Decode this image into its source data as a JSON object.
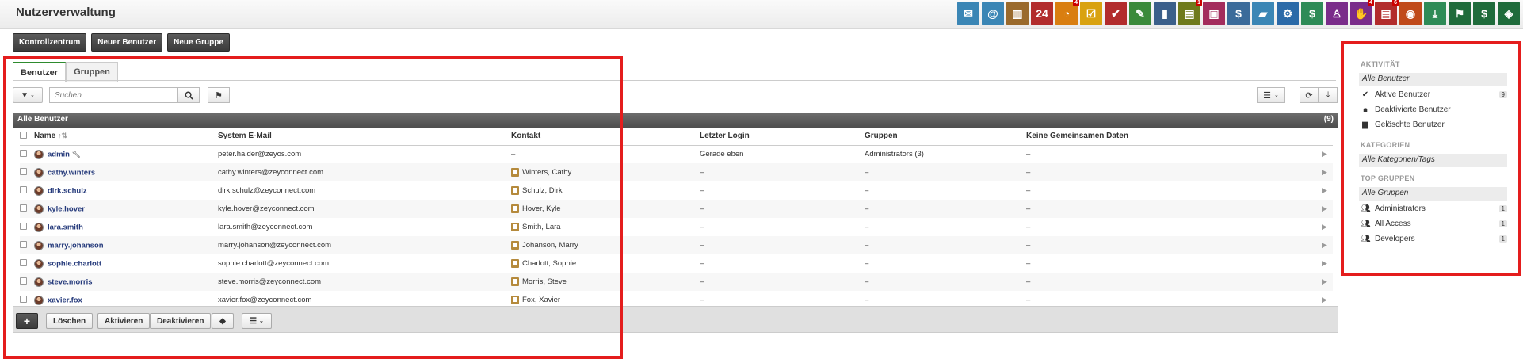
{
  "page_title": "Nutzerverwaltung",
  "apps": [
    {
      "icon": "mail-icon",
      "color": "#3b86b5",
      "glyph": "✉"
    },
    {
      "icon": "at-icon",
      "color": "#3b86b5",
      "glyph": "@"
    },
    {
      "icon": "addressbook-icon",
      "color": "#9a6a2c",
      "glyph": "▥"
    },
    {
      "icon": "calendar-icon",
      "color": "#b22c2c",
      "glyph": "24"
    },
    {
      "icon": "timer-icon",
      "color": "#d97e10",
      "glyph": "◔",
      "badge": "4"
    },
    {
      "icon": "tasks-icon",
      "color": "#d9a210",
      "glyph": "☑"
    },
    {
      "icon": "checklist-icon",
      "color": "#b22c2c",
      "glyph": "✔"
    },
    {
      "icon": "notes-icon",
      "color": "#3b8a3b",
      "glyph": "✎"
    },
    {
      "icon": "bookmark-icon",
      "color": "#3b5f8a",
      "glyph": "▮"
    },
    {
      "icon": "document-icon",
      "color": "#6f7a1c",
      "glyph": "▤",
      "badge": "1"
    },
    {
      "icon": "gift-icon",
      "color": "#a32c5c",
      "glyph": "▣"
    },
    {
      "icon": "dollar-icon",
      "color": "#3b6b9a",
      "glyph": "$"
    },
    {
      "icon": "truck-icon",
      "color": "#3b86b5",
      "glyph": "▰"
    },
    {
      "icon": "gear-icon",
      "color": "#2b6aa8",
      "glyph": "⚙"
    },
    {
      "icon": "money-icon",
      "color": "#2e8b57",
      "glyph": "$"
    },
    {
      "icon": "user-icon",
      "color": "#7a2c8a",
      "glyph": "♙"
    },
    {
      "icon": "handshake-icon",
      "color": "#7a2c8a",
      "glyph": "✋",
      "badge": "4"
    },
    {
      "icon": "receipt-icon",
      "color": "#b22c2c",
      "glyph": "▤",
      "badge": "6"
    },
    {
      "icon": "broadcast-icon",
      "color": "#c04a1a",
      "glyph": "◉"
    },
    {
      "icon": "download-icon",
      "color": "#2e8b57",
      "glyph": "⤓"
    },
    {
      "icon": "flag-book-icon",
      "color": "#1f6b3b",
      "glyph": "⚑"
    },
    {
      "icon": "invoice-icon",
      "color": "#1f6b3b",
      "glyph": "$"
    },
    {
      "icon": "tag-dollar-icon",
      "color": "#1f6b3b",
      "glyph": "◈"
    }
  ],
  "toolbar": {
    "control_center": "Kontrollzentrum",
    "new_user": "Neuer Benutzer",
    "new_group": "Neue Gruppe"
  },
  "tabs": {
    "users": "Benutzer",
    "groups": "Gruppen"
  },
  "search": {
    "placeholder": "Suchen"
  },
  "list": {
    "title": "Alle Benutzer",
    "count": "(9)",
    "columns": {
      "name": "Name",
      "email": "System E-Mail",
      "contact": "Kontakt",
      "last_login": "Letzter Login",
      "groups": "Gruppen",
      "no_shared": "Keine Gemeinsamen Daten"
    },
    "rows": [
      {
        "name": "admin",
        "email": "peter.haider@zeyos.com",
        "contact": "–",
        "last_login": "Gerade eben",
        "groups": "Administrators (3)",
        "no_shared": "–"
      },
      {
        "name": "cathy.winters",
        "email": "cathy.winters@zeyconnect.com",
        "contact": "Winters, Cathy",
        "last_login": "–",
        "groups": "–",
        "no_shared": "–"
      },
      {
        "name": "dirk.schulz",
        "email": "dirk.schulz@zeyconnect.com",
        "contact": "Schulz, Dirk",
        "last_login": "–",
        "groups": "–",
        "no_shared": "–"
      },
      {
        "name": "kyle.hover",
        "email": "kyle.hover@zeyconnect.com",
        "contact": "Hover, Kyle",
        "last_login": "–",
        "groups": "–",
        "no_shared": "–"
      },
      {
        "name": "lara.smith",
        "email": "lara.smith@zeyconnect.com",
        "contact": "Smith, Lara",
        "last_login": "–",
        "groups": "–",
        "no_shared": "–"
      },
      {
        "name": "marry.johanson",
        "email": "marry.johanson@zeyconnect.com",
        "contact": "Johanson, Marry",
        "last_login": "–",
        "groups": "–",
        "no_shared": "–"
      },
      {
        "name": "sophie.charlott",
        "email": "sophie.charlott@zeyconnect.com",
        "contact": "Charlott, Sophie",
        "last_login": "–",
        "groups": "–",
        "no_shared": "–"
      },
      {
        "name": "steve.morris",
        "email": "steve.morris@zeyconnect.com",
        "contact": "Morris, Steve",
        "last_login": "–",
        "groups": "–",
        "no_shared": "–"
      },
      {
        "name": "xavier.fox",
        "email": "xavier.fox@zeyconnect.com",
        "contact": "Fox, Xavier",
        "last_login": "–",
        "groups": "–",
        "no_shared": "–"
      }
    ]
  },
  "footer": {
    "delete": "Löschen",
    "activate": "Aktivieren",
    "deactivate": "Deaktivieren",
    "add": "+"
  },
  "sidebar": {
    "activity_head": "AKTIVITÄT",
    "all_users": "Alle Benutzer",
    "active_users": "Aktive Benutzer",
    "active_count": "9",
    "deactivated_users": "Deaktivierte Benutzer",
    "deleted_users": "Gelöschte Benutzer",
    "categories_head": "KATEGORIEN",
    "all_categories": "Alle Kategorien/Tags",
    "top_groups_head": "TOP GRUPPEN",
    "all_groups": "Alle Gruppen",
    "groups": [
      {
        "label": "Administrators",
        "count": "1"
      },
      {
        "label": "All Access",
        "count": "1"
      },
      {
        "label": "Developers",
        "count": "1"
      }
    ]
  },
  "highlight_color": "#e41d1d"
}
